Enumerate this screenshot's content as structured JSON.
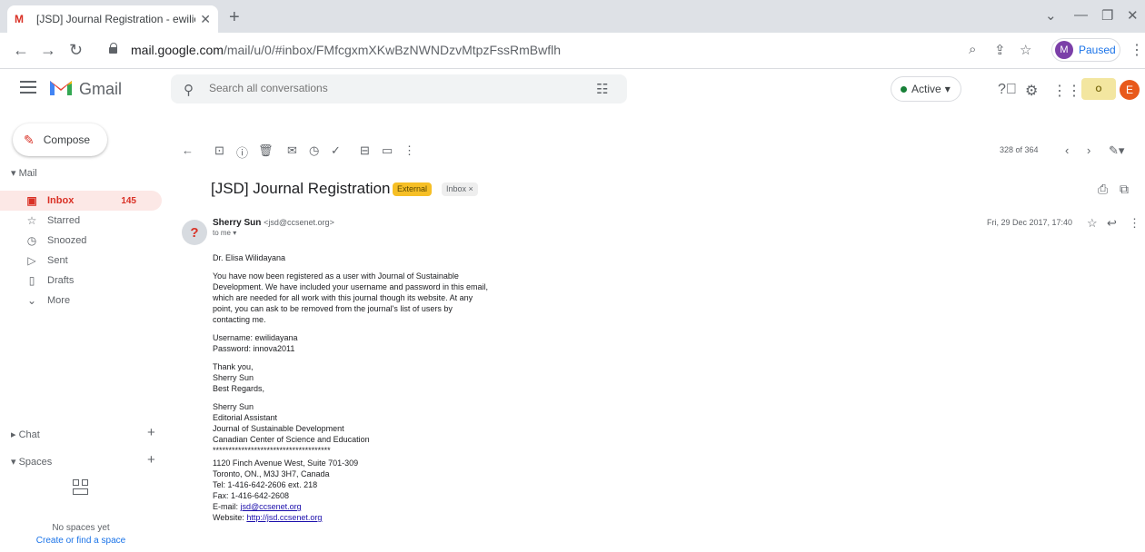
{
  "browser": {
    "tab_title": "[JSD] Journal Registration - ewilio",
    "tab_favicon": "M",
    "url_domain": "mail.google.com",
    "url_path": "/mail/u/0/#inbox/FMfcgxmXKwBzNWNDzvMtpzFssRmBwflh",
    "profile_initial": "M",
    "profile_status": "Paused"
  },
  "gmail": {
    "product_name": "Gmail",
    "search_placeholder": "Search all conversations",
    "status": "Active",
    "status_caret": "▾",
    "org_logo_text": "O",
    "user_initial": "E"
  },
  "sidebar": {
    "compose_label": "Compose",
    "mail_label": "Mail",
    "items": [
      {
        "label": "Inbox",
        "count": "145",
        "icon": "inbox-icon"
      },
      {
        "label": "Starred",
        "count": "",
        "icon": "star-icon"
      },
      {
        "label": "Snoozed",
        "count": "",
        "icon": "clock-icon"
      },
      {
        "label": "Sent",
        "count": "",
        "icon": "send-icon"
      },
      {
        "label": "Drafts",
        "count": "",
        "icon": "draft-icon"
      },
      {
        "label": "More",
        "count": "",
        "icon": "chevron-down-icon"
      }
    ],
    "chat_label": "Chat",
    "spaces_label": "Spaces",
    "no_spaces": "No spaces yet",
    "create_space": "Create or find a space"
  },
  "mail_toolbar": {
    "pager": "328 of 364"
  },
  "message": {
    "subject": "[JSD] Journal Registration",
    "badge_external": "External",
    "badge_inbox": "Inbox ×",
    "sender_initial": "?",
    "sender_name": "Sherry Sun",
    "sender_email": "<jsd@ccsenet.org>",
    "to": "to me ▾",
    "date": "Fri, 29 Dec 2017, 17:40",
    "greeting": "Dr. Elisa Wilidayana",
    "para1_l1": "You have now been registered as a user with Journal of Sustainable",
    "para1_l2": "Development. We have included your username and password in this email,",
    "para1_l3": "which are needed for all work with this journal though its website. At any",
    "para1_l4": "point, you can ask to be removed from the journal's list of users by",
    "para1_l5": "contacting me.",
    "username": "Username: ewilidayana",
    "password": "Password: innova2011",
    "thanks": "Thank you,",
    "sig_name1": "Sherry Sun",
    "best": "Best Regards,",
    "sig_name2": "Sherry Sun",
    "sig_title": "Editorial Assistant",
    "sig_journal": "Journal of Sustainable Development",
    "sig_org": "Canadian Center of Science and Education",
    "sig_rule": "*************************************",
    "addr1": "1120 Finch Avenue West, Suite 701-309",
    "addr2": "Toronto, ON., M3J 3H7, Canada",
    "tel": "Tel: 1-416-642-2606 ext. 218",
    "fax": "Fax: 1-416-642-2608",
    "email_label": "E-mail: ",
    "email_link": "jsd@ccsenet.org",
    "web_label": "Website: ",
    "web_link": "http://jsd.ccsenet.org"
  },
  "colors": {
    "accent_red": "#d93025",
    "link_blue": "#1a73e8",
    "external_badge": "#f6bf26"
  }
}
